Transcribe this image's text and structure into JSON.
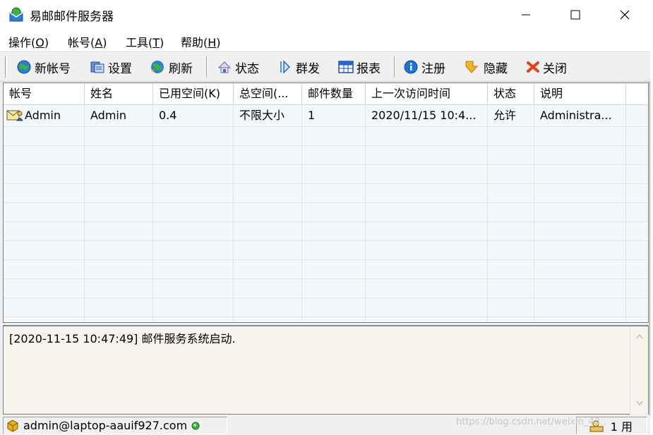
{
  "window": {
    "title": "易邮邮件服务器",
    "accent": "#3c8ad8"
  },
  "menu": [
    {
      "label": "操作(",
      "key": "O",
      "tail": ")"
    },
    {
      "label": "帐号(",
      "key": "A",
      "tail": ")"
    },
    {
      "label": "工具(",
      "key": "T",
      "tail": ")"
    },
    {
      "label": "帮助(",
      "key": "H",
      "tail": ")"
    }
  ],
  "toolbar": {
    "new_account": "新帐号",
    "settings": "设置",
    "refresh": "刷新",
    "status": "状态",
    "mass_send": "群发",
    "report": "报表",
    "register": "注册",
    "hide": "隐藏",
    "close": "关闭"
  },
  "table": {
    "columns": [
      "帐号",
      "姓名",
      "已用空间(K)",
      "总空间(...",
      "邮件数量",
      "上一次访问时间",
      "状态",
      "说明"
    ],
    "rows": [
      {
        "account": "Admin",
        "name": "Admin",
        "used": "0.4",
        "total": "不限大小",
        "mail_count": "1",
        "last_access": "2020/11/15 10:4...",
        "status": "允许",
        "note": "Administra..."
      }
    ]
  },
  "log": {
    "line": "[2020-11-15 10:47:49] 邮件服务系统启动."
  },
  "statusbar": {
    "user": "admin@laptop-aauif927.com",
    "online": "1 用"
  },
  "watermark": "https://blog.csdn.net/weixin_43.."
}
